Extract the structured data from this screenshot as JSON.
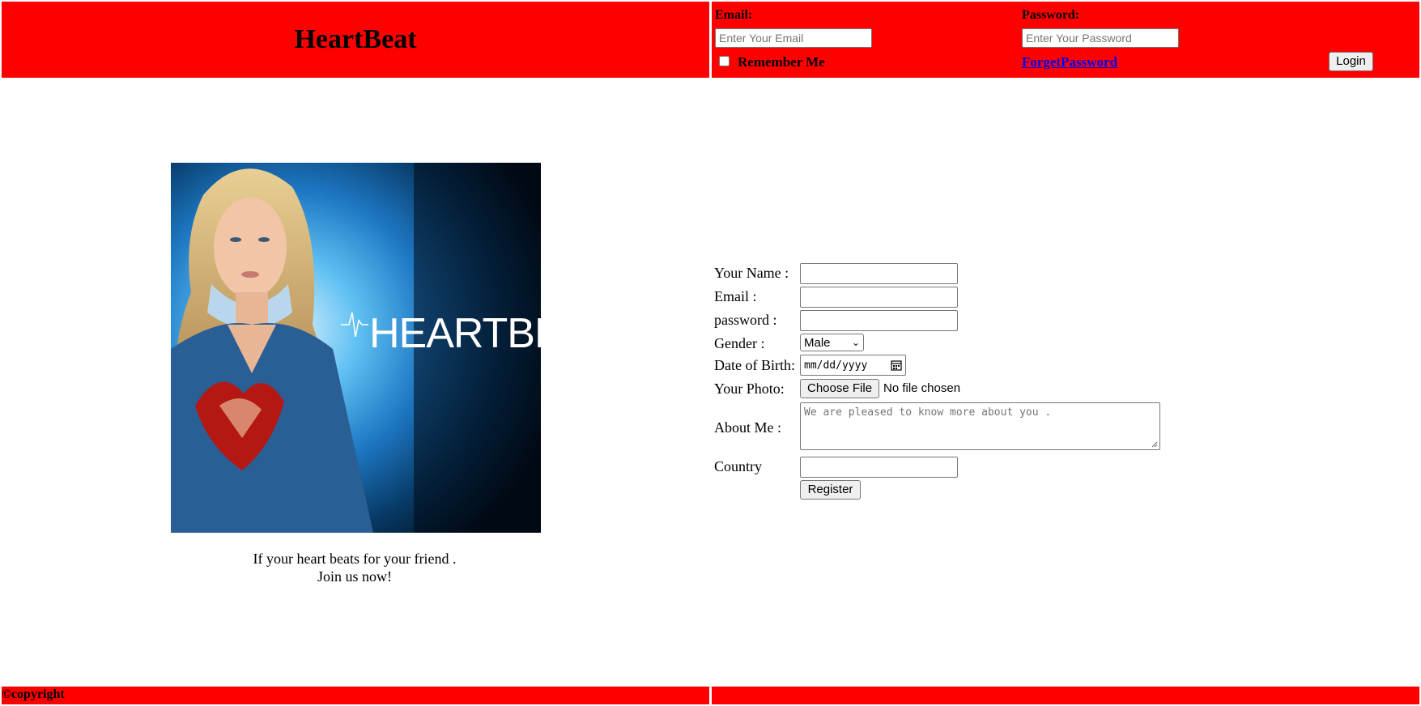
{
  "header": {
    "site_title": "HeartBeat",
    "login": {
      "email_label": "Email:",
      "email_placeholder": "Enter Your Email",
      "password_label": "Password:",
      "password_placeholder": "Enter Your Password",
      "remember_label": "Remember Me",
      "remember_checked": false,
      "forget_link": "ForgetPassword",
      "login_button": "Login"
    }
  },
  "hero": {
    "image_text": "HEARTBEAT",
    "tagline_line1": "If your heart beats for your friend .",
    "tagline_line2": "Join us now!"
  },
  "register_form": {
    "name_label": "Your Name :",
    "email_label": "Email :",
    "password_label": "password :",
    "gender_label": "Gender :",
    "gender_selected": "Male",
    "dob_label": "Date of Birth:",
    "dob_placeholder": "mm/dd/yyyy",
    "photo_label": "Your Photo:",
    "photo_button": "Choose File",
    "photo_status": "No file chosen",
    "about_label": "About Me :",
    "about_placeholder": "We are pleased to know more about you .",
    "country_label": "Country",
    "register_button": "Register"
  },
  "footer": {
    "copyright": "©copyright"
  },
  "colors": {
    "brand_red": "#ff0000",
    "link_blue": "#0000ee"
  }
}
